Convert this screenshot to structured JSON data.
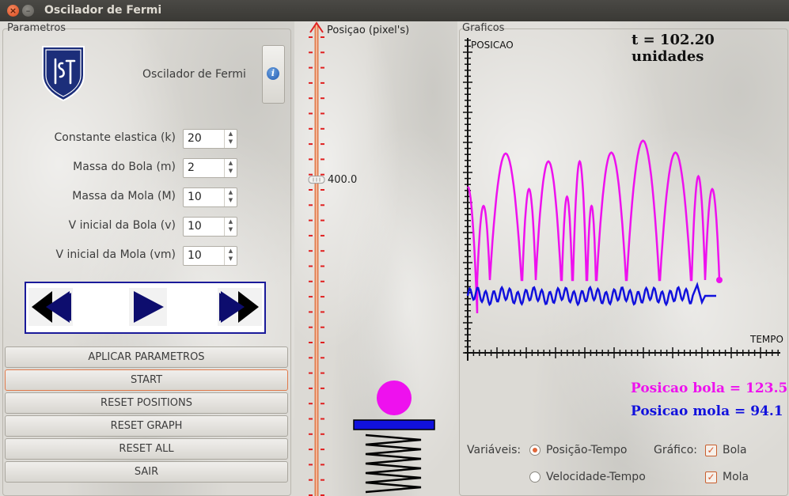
{
  "window": {
    "title": "Oscilador de Fermi",
    "close_icon": "×",
    "min_icon": "–"
  },
  "params": {
    "group_title": "Parametros",
    "app_name": "Oscilador de Fermi",
    "info_icon": "i",
    "fields": [
      {
        "label": "Constante elastica (k)",
        "value": "20"
      },
      {
        "label": "Massa do Bola (m)",
        "value": "2"
      },
      {
        "label": "Massa da Mola (M)",
        "value": "10"
      },
      {
        "label": "V inicial da Bola (v)",
        "value": "10"
      },
      {
        "label": "V inicial da Mola (vm)",
        "value": "10"
      }
    ],
    "buttons": [
      "APLICAR PARAMETROS",
      "START",
      "RESET POSITIONS",
      "RESET GRAPH",
      "RESET ALL",
      "SAIR"
    ]
  },
  "slider": {
    "label": "Posiçao (pixel's)",
    "value": "400.0",
    "value_fraction": 0.33
  },
  "graph": {
    "group_title": "Graficos",
    "time_label": "t = 102.20 unidades",
    "y_axis_label": "POSICAO",
    "x_axis_label": "TEMPO",
    "ball_text": "Posicao bola = 123.5",
    "spring_text": "Posicao mola = 94.1",
    "ball_color": "#ee11ee",
    "spring_color": "#1111dd",
    "variables_label": "Variáveis:",
    "opt_pos": "Posição-Tempo",
    "opt_vel": "Velocidade-Tempo",
    "grafico_label": "Gráfico:",
    "chk_ball": "Bola",
    "chk_spring": "Mola",
    "selected": "Posição-Tempo"
  }
}
